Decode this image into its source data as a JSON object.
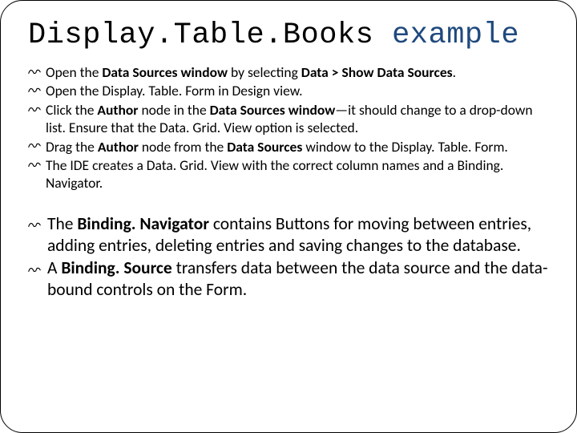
{
  "title": {
    "part1": "Display.Table.Books",
    "part2": "example"
  },
  "list_small": [
    {
      "segments": [
        {
          "t": "Open the "
        },
        {
          "t": "Data Sources window",
          "b": true
        },
        {
          "t": " by selecting "
        },
        {
          "t": "Data > Show Data Sources",
          "b": true
        },
        {
          "t": "."
        }
      ]
    },
    {
      "segments": [
        {
          "t": "Open the Display. Table. Form in Design view."
        }
      ]
    },
    {
      "segments": [
        {
          "t": "Click the "
        },
        {
          "t": "Author",
          "b": true
        },
        {
          "t": " node in the "
        },
        {
          "t": "Data Sources window",
          "b": true
        },
        {
          "t": "—it should change to a drop-down list. Ensure that the Data. Grid. View option is selected."
        }
      ]
    },
    {
      "segments": [
        {
          "t": "Drag the "
        },
        {
          "t": "Author",
          "b": true
        },
        {
          "t": " node from the "
        },
        {
          "t": "Data Sources",
          "b": true
        },
        {
          "t": " window to the Display. Table. Form."
        }
      ]
    },
    {
      "segments": [
        {
          "t": "The IDE creates a Data. Grid. View with the correct column names and a Binding. Navigator."
        }
      ]
    }
  ],
  "list_large": [
    {
      "segments": [
        {
          "t": "The "
        },
        {
          "t": "Binding. Navigator",
          "b": true
        },
        {
          "t": " contains Buttons for moving between entries, adding entries, deleting entries and saving changes to the database."
        }
      ]
    },
    {
      "segments": [
        {
          "t": "A "
        },
        {
          "t": "Binding. Source",
          "b": true
        },
        {
          "t": " transfers data between the data source and the data-bound controls on the Form."
        }
      ]
    }
  ],
  "bullet_glyph": "߷"
}
